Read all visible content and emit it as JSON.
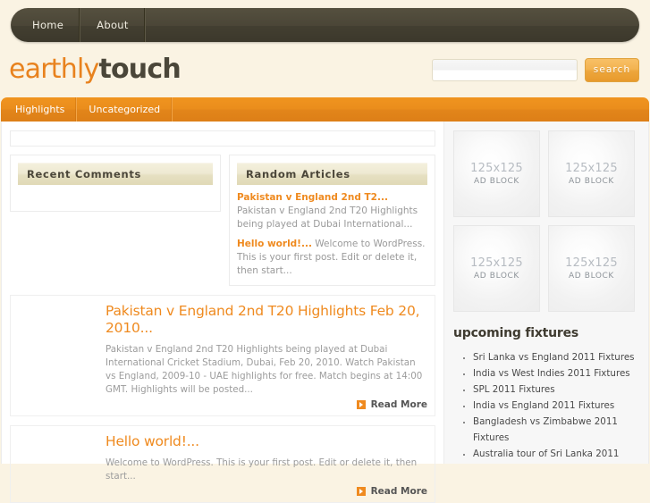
{
  "topnav": {
    "items": [
      {
        "label": "Home"
      },
      {
        "label": "About"
      }
    ]
  },
  "brand": {
    "logo_first": "earthly",
    "logo_second": "touch",
    "logo_color_first": "#e8821e",
    "logo_color_second": "#4a4639"
  },
  "search": {
    "value": "",
    "placeholder": "",
    "button_label": "search"
  },
  "categories": {
    "items": [
      {
        "label": "Highlights"
      },
      {
        "label": "Uncategorized"
      }
    ]
  },
  "widgets": {
    "recent_comments": {
      "title": "Recent Comments",
      "items": []
    },
    "random_articles": {
      "title": "Random Articles",
      "items": [
        {
          "link": "Pakistan v England 2nd T2...",
          "excerpt": " Pakistan v England 2nd T20 Highlights being played at Dubai International..."
        },
        {
          "link": "Hello world!...",
          "excerpt": " Welcome to WordPress. This is your first post. Edit or delete it, then start..."
        }
      ]
    }
  },
  "articles": [
    {
      "title": "Pakistan v England 2nd T20 Highlights Feb 20, 2010...",
      "excerpt": "Pakistan v England 2nd T20 Highlights being played at Dubai International Cricket Stadium, Dubai, Feb 20, 2010. Watch Pakistan vs England, 2009-10 - UAE highlights for free. Match begins at 14:00 GMT. Highlights will be posted...",
      "read_more": "Read More"
    },
    {
      "title": "Hello world!...",
      "excerpt": "Welcome to WordPress. This is your first post. Edit or delete it, then start...",
      "read_more": "Read More"
    }
  ],
  "sidebar": {
    "ads": [
      {
        "size": "125x125",
        "label": "AD BLOCK"
      },
      {
        "size": "125x125",
        "label": "AD BLOCK"
      },
      {
        "size": "125x125",
        "label": "AD BLOCK"
      },
      {
        "size": "125x125",
        "label": "AD BLOCK"
      }
    ],
    "fixtures_title": "upcoming fixtures",
    "fixtures": [
      {
        "label": "Sri Lanka vs England 2011 Fixtures"
      },
      {
        "label": "India vs West Indies 2011 Fixtures"
      },
      {
        "label": "SPL 2011 Fixtures"
      },
      {
        "label": "India vs England 2011 Fixtures"
      },
      {
        "label": "Bangladesh vs Zimbabwe 2011 Fixtures"
      },
      {
        "label": "Australia tour of Sri Lanka 2011"
      }
    ]
  },
  "theme": {
    "page_background": "#faf3e3",
    "accent_orange": "#ef8a1f",
    "nav_dark": "#4b4637"
  }
}
